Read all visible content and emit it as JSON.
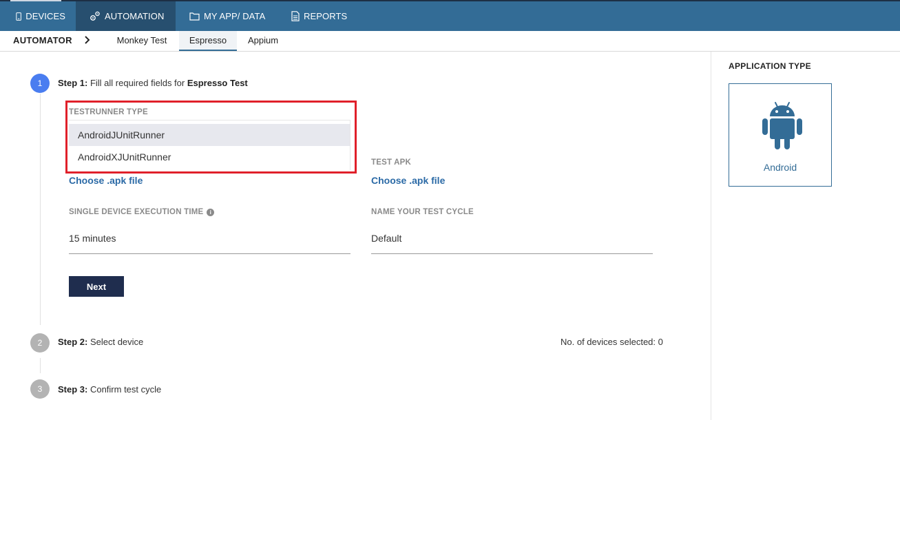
{
  "topnav": {
    "items": [
      {
        "label": "DEVICES",
        "icon": "phone-icon"
      },
      {
        "label": "AUTOMATION",
        "icon": "gears-icon",
        "active": true
      },
      {
        "label": "MY APP/ DATA",
        "icon": "folder-icon"
      },
      {
        "label": "REPORTS",
        "icon": "document-icon"
      }
    ]
  },
  "subnav": {
    "title": "AUTOMATOR",
    "tabs": [
      {
        "label": "Monkey Test"
      },
      {
        "label": "Espresso",
        "active": true
      },
      {
        "label": "Appium"
      }
    ]
  },
  "steps": [
    {
      "number": "1",
      "prefix": "Step 1:",
      "text": " Fill all required fields for ",
      "bold_suffix": "Espresso Test"
    },
    {
      "number": "2",
      "prefix": "Step 2:",
      "text": " Select device",
      "right_text": "No. of devices selected: 0"
    },
    {
      "number": "3",
      "prefix": "Step 3:",
      "text": " Confirm test cycle"
    }
  ],
  "form": {
    "testrunner": {
      "label": "TESTRUNNER TYPE",
      "options": [
        "AndroidJUnitRunner",
        "AndroidXJUnitRunner"
      ],
      "selected": "AndroidJUnitRunner"
    },
    "app_apk_link": "Choose .apk file",
    "test_apk": {
      "label": "TEST APK",
      "link": "Choose .apk file"
    },
    "execution_time": {
      "label": "SINGLE DEVICE EXECUTION TIME",
      "value": "15 minutes"
    },
    "test_cycle": {
      "label": "NAME YOUR TEST CYCLE",
      "value": "Default"
    },
    "next_label": "Next"
  },
  "right_panel": {
    "title": "APPLICATION TYPE",
    "app_label": "Android",
    "accent_color": "#336c96"
  },
  "colors": {
    "nav_bg": "#336c96",
    "highlight_border": "#e0202a",
    "step_active": "#4a7df0",
    "button_bg": "#1f2d4e"
  }
}
